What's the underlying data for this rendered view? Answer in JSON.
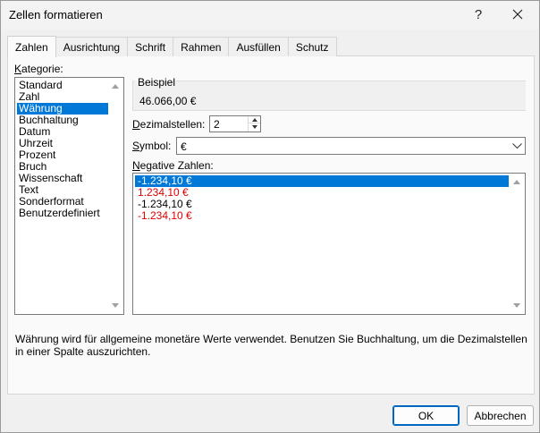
{
  "window": {
    "title": "Zellen formatieren",
    "help_label": "?"
  },
  "tabs": [
    {
      "label": "Zahlen",
      "active": true
    },
    {
      "label": "Ausrichtung",
      "active": false
    },
    {
      "label": "Schrift",
      "active": false
    },
    {
      "label": "Rahmen",
      "active": false
    },
    {
      "label": "Ausfüllen",
      "active": false
    },
    {
      "label": "Schutz",
      "active": false
    }
  ],
  "category": {
    "label_first": "K",
    "label_rest": "ategorie:",
    "items": [
      "Standard",
      "Zahl",
      "Währung",
      "Buchhaltung",
      "Datum",
      "Uhrzeit",
      "Prozent",
      "Bruch",
      "Wissenschaft",
      "Text",
      "Sonderformat",
      "Benutzerdefiniert"
    ],
    "selected": "Währung"
  },
  "sample": {
    "label": "Beispiel",
    "value": "46.066,00 €"
  },
  "decimals": {
    "label_first": "D",
    "label_rest": "ezimalstellen:",
    "value": "2"
  },
  "symbol": {
    "label_first": "S",
    "label_rest": "ymbol:",
    "value": "€"
  },
  "negative": {
    "label_first": "N",
    "label_rest": "egative Zahlen:",
    "items": [
      {
        "text": "-1.234,10 €",
        "color": "#000000",
        "selected": true
      },
      {
        "text": "1.234,10 €",
        "color": "#e00000",
        "selected": false
      },
      {
        "text": "-1.234,10 €",
        "color": "#000000",
        "selected": false
      },
      {
        "text": "-1.234,10 €",
        "color": "#e00000",
        "selected": false
      }
    ]
  },
  "description": "Währung wird für allgemeine monetäre Werte verwendet. Benutzen Sie Buchhaltung, um die Dezimalstellen in einer Spalte auszurichten.",
  "buttons": {
    "ok": "OK",
    "cancel": "Abbrechen"
  },
  "colors": {
    "selection": "#0078d7",
    "negative_red": "#e00000"
  }
}
